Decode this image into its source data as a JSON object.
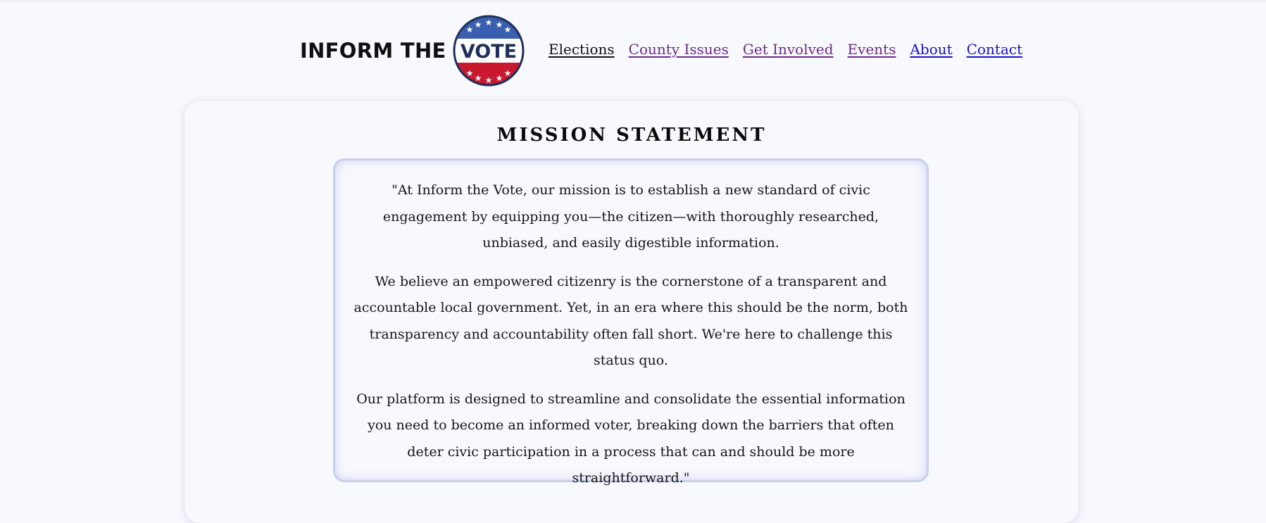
{
  "header": {
    "logo": {
      "text": "INFORM THE",
      "badge_text": "VOTE",
      "badge_colors": {
        "blue": "#3b5fb0",
        "red": "#c8192e",
        "ring": "#1f2f5c"
      }
    },
    "nav": [
      {
        "label": "Elections",
        "state": "current"
      },
      {
        "label": "County Issues",
        "state": "visited"
      },
      {
        "label": "Get Involved",
        "state": "visited"
      },
      {
        "label": "Events",
        "state": "visited"
      },
      {
        "label": "About",
        "state": "link"
      },
      {
        "label": "Contact",
        "state": "link"
      }
    ]
  },
  "mission": {
    "title": "MISSION STATEMENT",
    "paragraphs": [
      "\"At Inform the Vote, our mission is to establish a new standard of civic engagement by equipping you—the citizen—with thoroughly researched, unbiased, and easily digestible information.",
      "We believe an empowered citizenry is the cornerstone of a transparent and accountable local government. Yet, in an era where this should be the norm, both transparency and accountability often fall short. We're here to challenge this status quo.",
      "Our platform is designed to streamline and consolidate the essential information you need to become an informed voter, breaking down the barriers that often deter civic participation in a process that can and should be more straightforward.\""
    ]
  },
  "colors": {
    "page_background": "#f8f9fe",
    "link_visited": "#6a2a8a",
    "link_unvisited": "#1a10cc",
    "quote_border": "#c9d0ec"
  }
}
